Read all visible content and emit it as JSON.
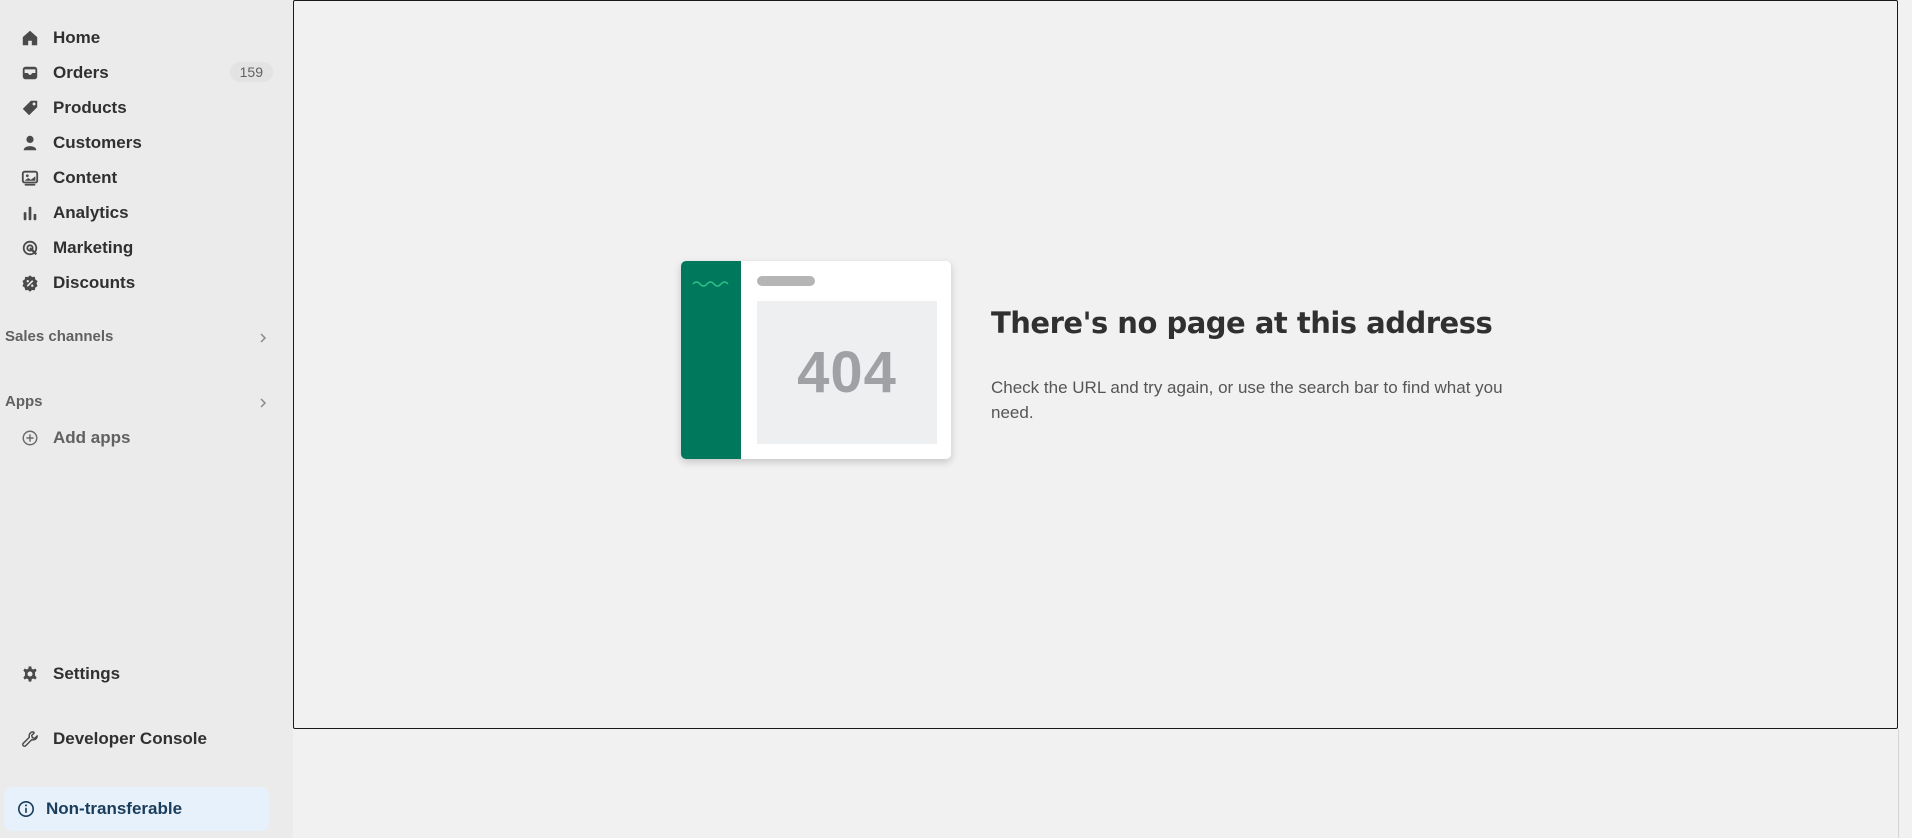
{
  "sidebar": {
    "items": [
      {
        "label": "Home",
        "icon": "home-icon"
      },
      {
        "label": "Orders",
        "icon": "inbox-icon",
        "badge": "159"
      },
      {
        "label": "Products",
        "icon": "tag-icon"
      },
      {
        "label": "Customers",
        "icon": "person-icon"
      },
      {
        "label": "Content",
        "icon": "image-icon"
      },
      {
        "label": "Analytics",
        "icon": "bar-chart-icon"
      },
      {
        "label": "Marketing",
        "icon": "target-icon"
      },
      {
        "label": "Discounts",
        "icon": "discount-icon"
      }
    ],
    "sales_channels": "Sales channels",
    "apps": "Apps",
    "add_apps": "Add apps",
    "settings": "Settings",
    "developer_console": "Developer Console",
    "non_transferable": "Non-transferable"
  },
  "error_page": {
    "code": "404",
    "heading": "There's no page at this address",
    "description": "Check the URL and try again, or use the search bar to find what you need."
  },
  "colors": {
    "sidebar_bg": "#ebebeb",
    "page_bg": "#f1f1f1",
    "brand_green": "#00785b",
    "banner_bg": "#e6f1fb"
  }
}
